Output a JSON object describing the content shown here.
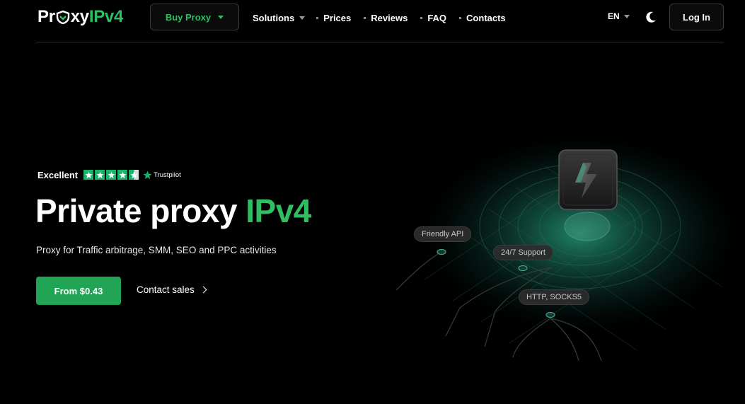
{
  "header": {
    "logo": {
      "part1": "Pr",
      "part2": "xy",
      "part3": "IPv4"
    },
    "buy_button": "Buy Proxy",
    "nav": {
      "solutions": "Solutions",
      "prices": "Prices",
      "reviews": "Reviews",
      "faq": "FAQ",
      "contacts": "Contacts"
    },
    "language": "EN",
    "theme_icon": "moon-icon",
    "login": "Log In"
  },
  "hero": {
    "rating_label": "Excellent",
    "rating_stars": 4.5,
    "trustpilot": "Trustpilot",
    "title_main": "Private proxy ",
    "title_accent": "IPv4",
    "subtitle": "Proxy for Traffic arbitrage, SMM, SEO and PPC activities",
    "cta": "From $0.43",
    "contact_link": "Contact sales"
  },
  "illustration": {
    "tags": [
      "Friendly API",
      "24/7 Support",
      "HTTP, SOCKS5"
    ],
    "center_icon": "lightning-icon"
  },
  "colors": {
    "accent": "#2fbf62",
    "button": "#21a455",
    "trustpilot": "#19b36a",
    "background": "#000000"
  }
}
